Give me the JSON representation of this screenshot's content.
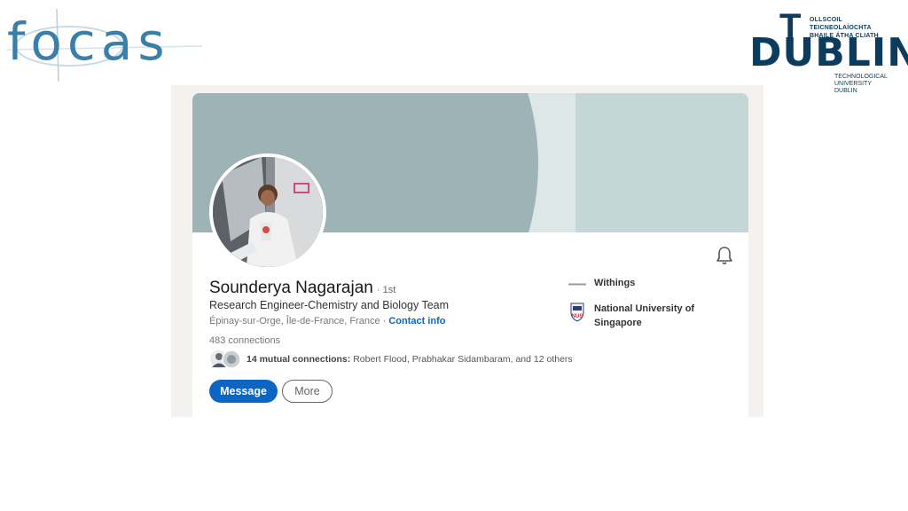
{
  "logos": {
    "focas": "focas",
    "tudublin": {
      "irish_line1": "OLLSCOIL TEICNEOLAÍOCHTA",
      "irish_line2": "BHAILE ÁTHA CLIATH",
      "wordmark_t": "T",
      "wordmark": "DUBLIN",
      "english_line1": "TECHNOLOGICAL",
      "english_line2": "UNIVERSITY DUBLIN"
    }
  },
  "profile": {
    "name": "Sounderya Nagarajan",
    "degree": "· 1st",
    "headline": "Research Engineer-Chemistry and Biology Team",
    "location": "Épinay-sur-Orge, Île-de-France, France ·",
    "contact_info": "Contact info",
    "connections": "483 connections",
    "mutual": {
      "count_text": "14 mutual connections:",
      "names_text": "Robert Flood, Prabhakar Sidambaram, and 12 others"
    },
    "buttons": {
      "message": "Message",
      "more": "More"
    },
    "experience": [
      {
        "name": "Withings",
        "logo_text": "WITHINGS",
        "icon": "withings-logo"
      },
      {
        "name_line1": "National University of",
        "name_line2": "Singapore",
        "logo_text": "NUS",
        "icon": "nus-logo"
      }
    ]
  },
  "colors": {
    "accent": "#0a66c2",
    "banner": "#c5d6d7",
    "banner_dark": "#9db3b5",
    "logo_blue": "#3a7fa8",
    "tud_navy": "#0b3c5d"
  }
}
